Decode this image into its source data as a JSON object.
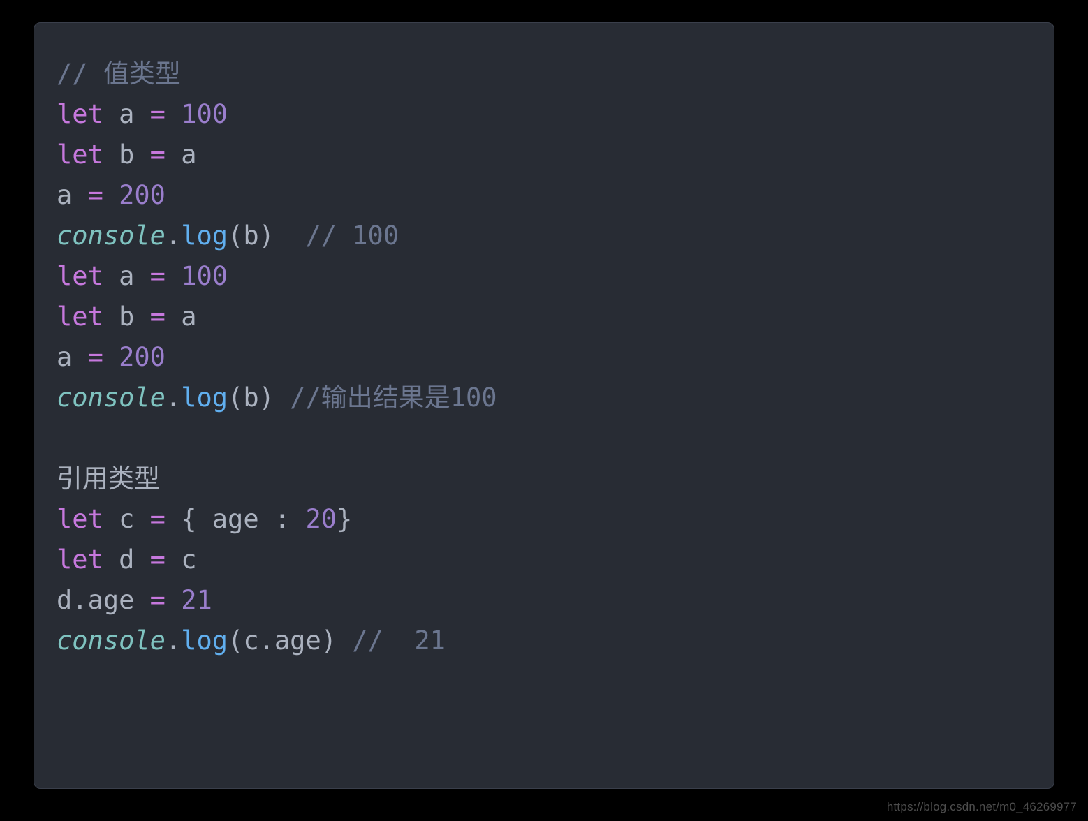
{
  "code": {
    "line1_comment": "// 值类型",
    "line2_let": "let",
    "line2_a": " a ",
    "line2_eq": "= ",
    "line2_num": "100",
    "line3_let": "let",
    "line3_b": " b ",
    "line3_eq": "= ",
    "line3_a": "a",
    "line4_a": "a ",
    "line4_eq": "= ",
    "line4_num": "200",
    "line5_console": "console",
    "line5_dot": ".",
    "line5_log": "log",
    "line5_open": "(",
    "line5_arg": "b",
    "line5_close": ")  ",
    "line5_comment": "// 100",
    "line6_let": "let",
    "line6_a": " a ",
    "line6_eq": "= ",
    "line6_num": "100",
    "line7_let": "let",
    "line7_b": " b ",
    "line7_eq": "= ",
    "line7_a": "a",
    "line8_a": "a ",
    "line8_eq": "= ",
    "line8_num": "200",
    "line9_console": "console",
    "line9_dot": ".",
    "line9_log": "log",
    "line9_open": "(",
    "line9_arg": "b",
    "line9_close": ") ",
    "line9_comment": "//输出结果是100",
    "line11_text": "引用类型",
    "line12_let": "let",
    "line12_c": " c ",
    "line12_eq": "= ",
    "line12_brace_open": "{ ",
    "line12_key": "age ",
    "line12_colon": ": ",
    "line12_val": "20",
    "line12_brace_close": "}",
    "line13_let": "let",
    "line13_d": " d ",
    "line13_eq": "= ",
    "line13_c": "c",
    "line14_d": "d",
    "line14_dot": ".",
    "line14_age": "age ",
    "line14_eq": "= ",
    "line14_num": "21",
    "line15_console": "console",
    "line15_dot": ".",
    "line15_log": "log",
    "line15_open": "(",
    "line15_arg_c": "c",
    "line15_arg_dot": ".",
    "line15_arg_age": "age",
    "line15_close": ") ",
    "line15_comment": "//  21"
  },
  "watermark": "https://blog.csdn.net/m0_46269977"
}
